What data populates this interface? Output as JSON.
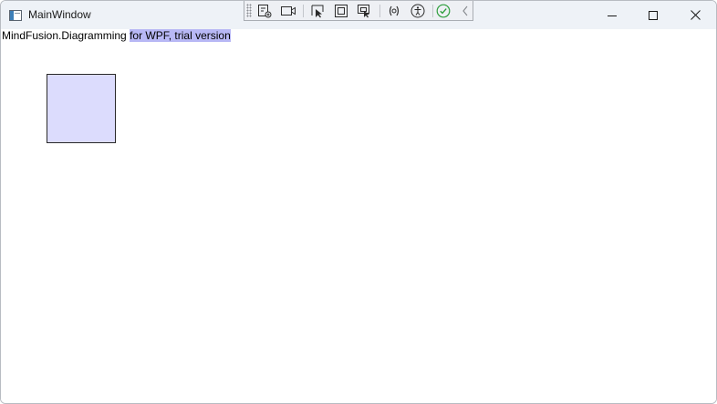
{
  "window": {
    "title": "MainWindow"
  },
  "debug_toolbar": {
    "buttons": [
      {
        "icon": "live-visual-tree-icon"
      },
      {
        "icon": "record-video-icon"
      },
      {
        "icon": "select-element-icon"
      },
      {
        "icon": "display-layout-adorners-icon"
      },
      {
        "icon": "track-focus-icon"
      },
      {
        "icon": "binding-failures-icon"
      },
      {
        "icon": "accessibility-icon"
      },
      {
        "icon": "hot-reload-ok-icon"
      },
      {
        "icon": "collapse-toolbar-icon"
      }
    ]
  },
  "client": {
    "trial_text_plain": "MindFusion.Diagramming ",
    "trial_text_highlight": "for WPF, trial version"
  },
  "colors": {
    "titlebar_bg": "#eef2f7",
    "highlight": "#b8b8f5",
    "node_fill": "#dcdcfd",
    "node_stroke": "#2a2a2a",
    "hot_reload_ok": "#2e9e3c"
  }
}
